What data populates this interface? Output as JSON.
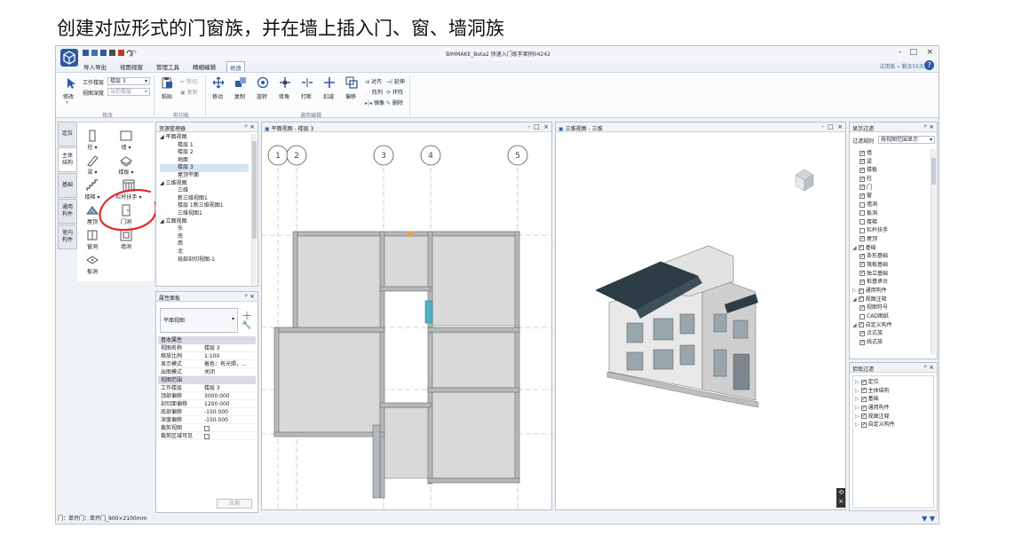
{
  "caption": "创建对应形式的门窗族，并在墙上插入门、窗、墙洞族",
  "window": {
    "title": "BIMMAKE_Beta2 快速入门练手案例04242",
    "minimize": "-",
    "maximize": "□",
    "close": "×"
  },
  "menu": [
    "导入导出",
    "视图视窗",
    "管理工具",
    "精细编辑",
    "修改"
  ],
  "trial": {
    "label": "试用版",
    "days": "剩余55天"
  },
  "help_label": "?",
  "ribbon": {
    "modify": {
      "label": "修改",
      "group": "修改"
    },
    "work_level_label": "工作楼层",
    "work_level_value": "楼层 3",
    "view_depth_label": "视图深度",
    "view_depth_value": "当前楼层",
    "paste": "粘贴",
    "cut": "剪切",
    "copy_clip": "复制",
    "clipboard_group": "剪切板",
    "tools": [
      "移动",
      "复制",
      "旋转",
      "修角",
      "打断",
      "扣减",
      "偏移"
    ],
    "align": "对齐",
    "extend": "延伸",
    "array": "阵列",
    "ring": "环阵",
    "mirror": "镜像",
    "delete": "删除",
    "general_group": "通用编辑"
  },
  "left_tabs": [
    "定位",
    "主体结构",
    "基础",
    "通用构件",
    "室内构件"
  ],
  "palette": [
    {
      "label": "柱"
    },
    {
      "label": "墙"
    },
    {
      "label": "梁"
    },
    {
      "label": "楼板"
    },
    {
      "label": "楼梯"
    },
    {
      "label": "栏杆扶手"
    },
    {
      "label": "屋顶"
    },
    {
      "label": "门洞"
    },
    {
      "label": "窗洞"
    },
    {
      "label": "墙洞"
    },
    {
      "label": "板洞"
    }
  ],
  "resource_manager": {
    "title": "资源管理器",
    "items": [
      {
        "text": "◢ 平面视图",
        "indent": 0
      },
      {
        "text": "楼层 1",
        "indent": 2
      },
      {
        "text": "楼层 2",
        "indent": 2
      },
      {
        "text": "地面",
        "indent": 2
      },
      {
        "text": "楼层 3",
        "indent": 2,
        "selected": true
      },
      {
        "text": "屋顶平面",
        "indent": 2
      },
      {
        "text": "◢ 三维视图",
        "indent": 0
      },
      {
        "text": "三维",
        "indent": 2
      },
      {
        "text": "新三维视图1",
        "indent": 2
      },
      {
        "text": "楼层 1新三维视图1",
        "indent": 2
      },
      {
        "text": "三维视图1",
        "indent": 2
      },
      {
        "text": "◢ 立面视图",
        "indent": 0
      },
      {
        "text": "东",
        "indent": 2
      },
      {
        "text": "南",
        "indent": 2
      },
      {
        "text": "西",
        "indent": 2
      },
      {
        "text": "北",
        "indent": 2
      },
      {
        "text": "局部剖切视图-1",
        "indent": 2
      }
    ]
  },
  "properties": {
    "title": "属性面板",
    "type": "平面视图",
    "sections": [
      {
        "title": "基本属性",
        "rows": [
          {
            "k": "视图名称",
            "v": "楼层 3"
          },
          {
            "k": "缩放比例",
            "v": "1:100"
          },
          {
            "k": "显示模式",
            "v": "着色：有光照，..."
          },
          {
            "k": "出图模式",
            "v": "关闭"
          }
        ]
      },
      {
        "title": "视图范围",
        "rows": [
          {
            "k": "工作楼层",
            "v": "楼层 3"
          },
          {
            "k": "顶部偏移",
            "v": "3000.000"
          },
          {
            "k": "剖切面偏移",
            "v": "1200.000"
          },
          {
            "k": "底部偏移",
            "v": "-150.000"
          },
          {
            "k": "深度偏移",
            "v": "-150.000"
          },
          {
            "k": "裁剪视图",
            "v": "checkbox"
          },
          {
            "k": "裁剪区域可见",
            "v": "checkbox"
          }
        ]
      }
    ],
    "apply": "应用"
  },
  "plan_view": {
    "title": "平面视图 - 楼层 3",
    "grid_labels": [
      "1",
      "2",
      "3",
      "4",
      "5"
    ]
  },
  "view3d": {
    "title": "三维视图 - 三维"
  },
  "display_filter": {
    "title": "显示过滤",
    "rule_label": "过滤规则",
    "rule_value": "按视图范围显示",
    "items": [
      {
        "text": "墙",
        "level": 1,
        "checked": true
      },
      {
        "text": "梁",
        "level": 1,
        "checked": true
      },
      {
        "text": "楼板",
        "level": 1,
        "checked": true
      },
      {
        "text": "柱",
        "level": 1,
        "checked": true
      },
      {
        "text": "门",
        "level": 1,
        "checked": true
      },
      {
        "text": "窗",
        "level": 1,
        "checked": true
      },
      {
        "text": "墙洞",
        "level": 1,
        "checked": false
      },
      {
        "text": "板洞",
        "level": 1,
        "checked": false
      },
      {
        "text": "楼梯",
        "level": 1,
        "checked": false
      },
      {
        "text": "栏杆扶手",
        "level": 1,
        "checked": false
      },
      {
        "text": "屋顶",
        "level": 1,
        "checked": true
      },
      {
        "text": "基础",
        "level": 0,
        "checked": true,
        "arrow": "◢"
      },
      {
        "text": "条形基础",
        "level": 1,
        "checked": true
      },
      {
        "text": "筏板基础",
        "level": 1,
        "checked": true
      },
      {
        "text": "独立基础",
        "level": 1,
        "checked": true
      },
      {
        "text": "桩基承台",
        "level": 1,
        "checked": true
      },
      {
        "text": "通用构件",
        "level": 0,
        "checked": true,
        "arrow": "▷"
      },
      {
        "text": "视图注释",
        "level": 0,
        "checked": true,
        "arrow": "◢"
      },
      {
        "text": "视图符号",
        "level": 1,
        "checked": true
      },
      {
        "text": "CAD图纸",
        "level": 1,
        "checked": false
      },
      {
        "text": "自定义构件",
        "level": 0,
        "checked": true,
        "arrow": "◢"
      },
      {
        "text": "点式族",
        "level": 1,
        "checked": true
      },
      {
        "text": "线式族",
        "level": 1,
        "checked": true
      }
    ]
  },
  "pick_filter": {
    "title": "拾取过滤",
    "items": [
      "定位",
      "主体结构",
      "基础",
      "通用构件",
      "视图注释",
      "自定义构件"
    ]
  },
  "status": "门：单开门：单开门_900×2100mm",
  "colors": {
    "accent": "#2c5aa0",
    "annotation": "#e0262b",
    "roof": "#2e3d45",
    "door_highlight": "#4fb3bf"
  }
}
